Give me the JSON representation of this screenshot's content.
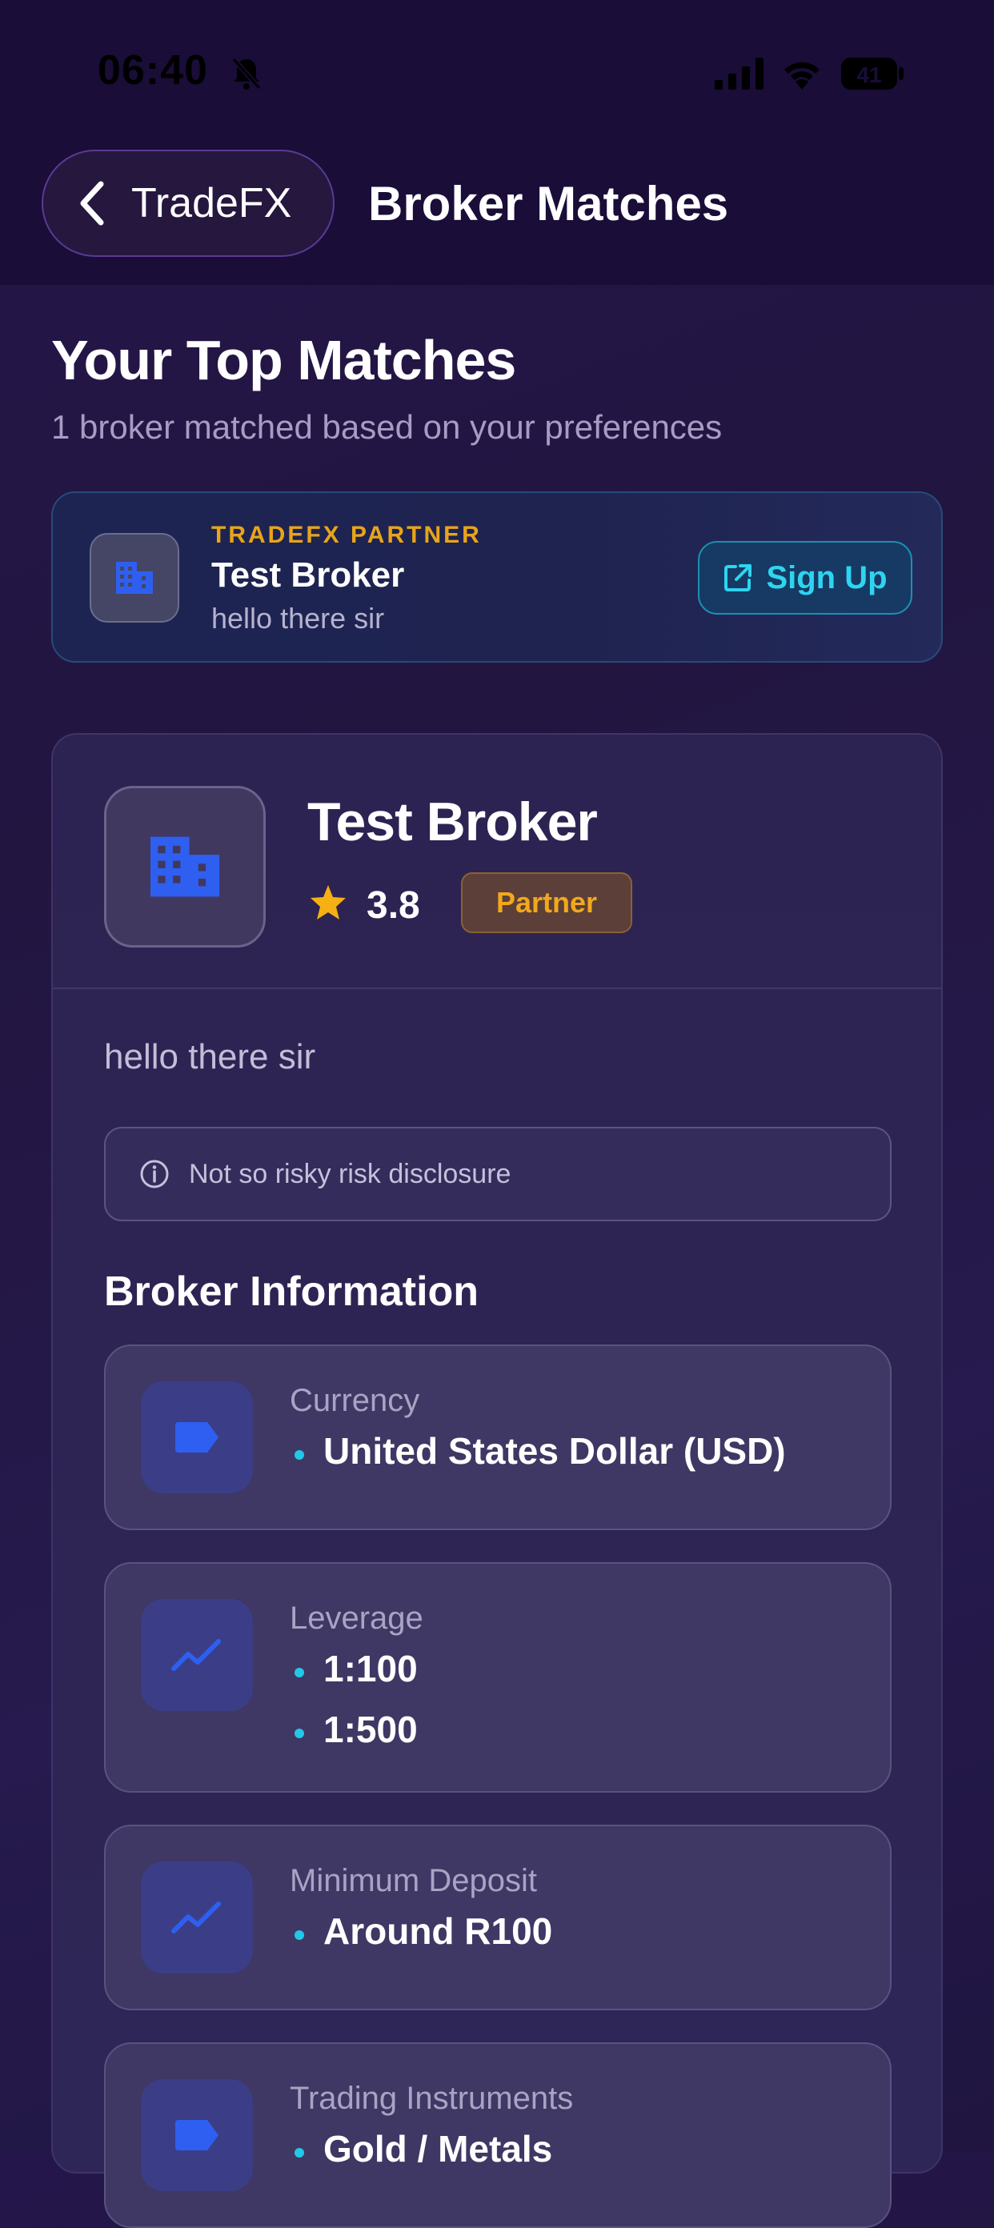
{
  "status_bar": {
    "time": "06:40",
    "battery": "41"
  },
  "nav": {
    "back_label": "TradeFX",
    "title": "Broker Matches"
  },
  "matches": {
    "title": "Your Top Matches",
    "subtitle": "1 broker matched based on your preferences"
  },
  "partner_card": {
    "tag": "TRADEFX PARTNER",
    "name": "Test Broker",
    "description": "hello there sir",
    "signup_label": "Sign Up"
  },
  "broker": {
    "name": "Test Broker",
    "rating": "3.8",
    "badge": "Partner",
    "description": "hello there sir",
    "risk_disclosure": "Not so risky risk disclosure",
    "info_heading": "Broker Information",
    "info": [
      {
        "label": "Currency",
        "icon": "tag-icon",
        "values": [
          "United States Dollar (USD)"
        ]
      },
      {
        "label": "Leverage",
        "icon": "trending-up-icon",
        "values": [
          "1:100",
          "1:500"
        ]
      },
      {
        "label": "Minimum Deposit",
        "icon": "trending-up-icon",
        "values": [
          "Around R100"
        ]
      },
      {
        "label": "Trading Instruments",
        "icon": "tag-icon",
        "values": [
          "Gold / Metals"
        ]
      }
    ]
  },
  "colors": {
    "accent_cyan": "#2ed4f0",
    "partner_gold": "#f2a81c",
    "icon_blue": "#2f5ff0",
    "background": "#241848"
  }
}
